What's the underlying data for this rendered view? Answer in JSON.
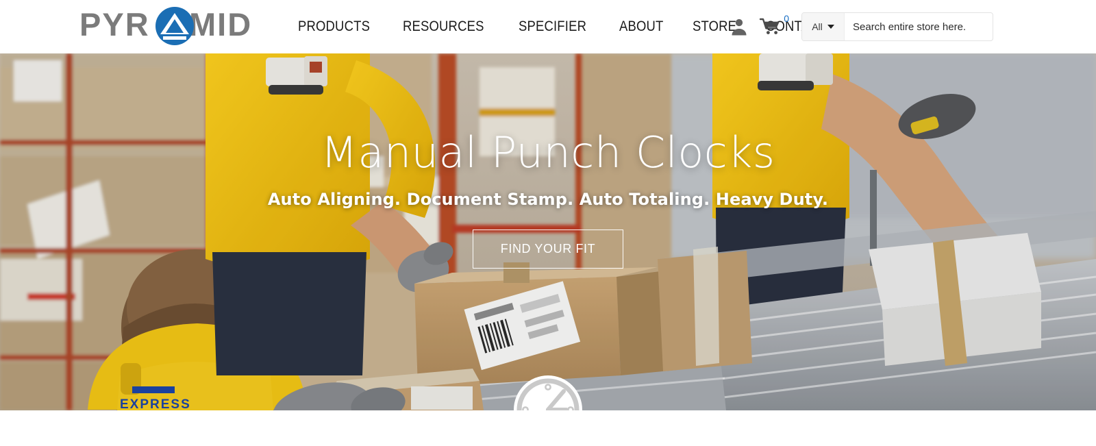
{
  "brand": {
    "name": "PYRAMID",
    "logo_text_color": "#7b7b7b",
    "logo_mark_color": "#1b6eb4",
    "logo_icon": "pyramid-triangle-in-circle-icon"
  },
  "header": {
    "nav": [
      {
        "label": "PRODUCTS"
      },
      {
        "label": "RESOURCES"
      },
      {
        "label": "SPECIFIER"
      },
      {
        "label": "ABOUT"
      },
      {
        "label": "STORE"
      },
      {
        "label": "CONTACT"
      }
    ],
    "account": {
      "icon": "user-account-icon"
    },
    "cart": {
      "icon": "shopping-cart-icon",
      "count": "0",
      "count_color": "#1a6fc4"
    },
    "search": {
      "scope_label": "All",
      "scope_caret_icon": "chevron-down-icon",
      "placeholder": "Search entire store here.",
      "value": "",
      "submit_icon": "search-icon",
      "submit_icon_color": "#1464b4"
    }
  },
  "hero": {
    "title": "Manual Punch Clocks",
    "subtitle": "Auto Aligning. Document Stamp. Auto Totaling. Heavy Duty.",
    "cta_label": "FIND YOUR FIT",
    "background_alt": "warehouse-workers-packing-boxes-on-conveyor",
    "clock_icon": "analog-clock-icon"
  }
}
